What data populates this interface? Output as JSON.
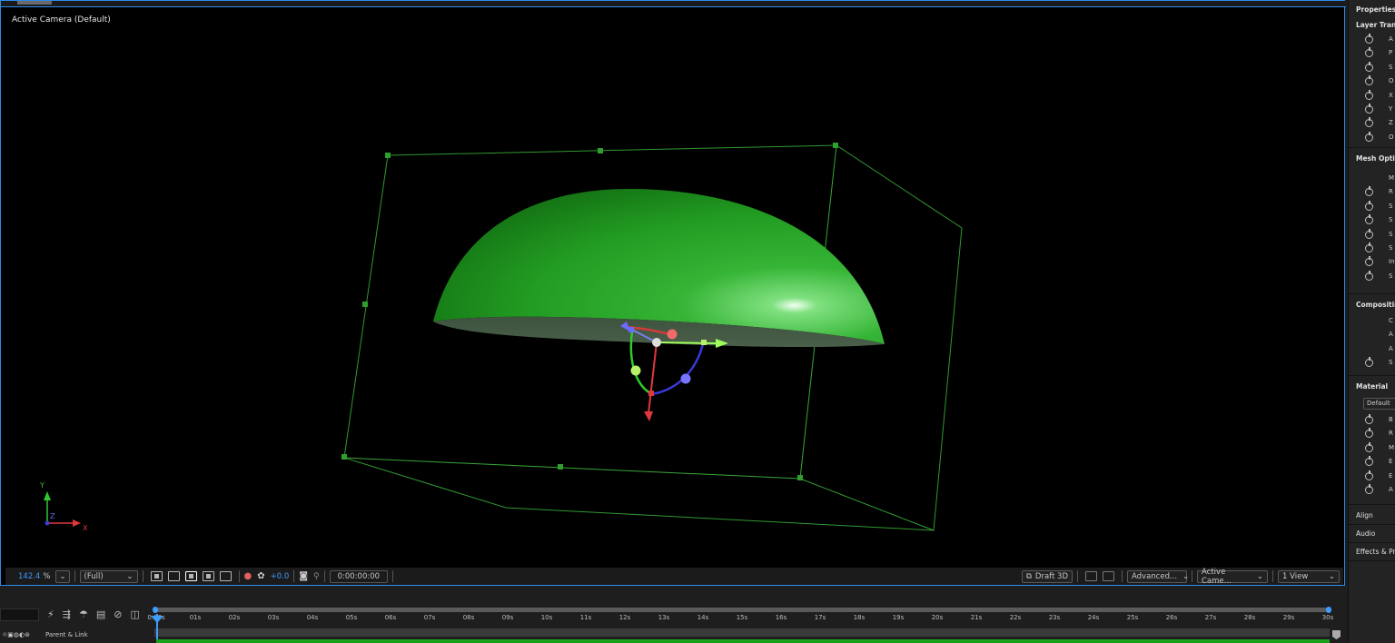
{
  "viewer": {
    "camera_label": "Active Camera (Default)",
    "axis_labels": {
      "y": "Y",
      "z": "Z",
      "x": "X"
    }
  },
  "toolbar": {
    "zoom": "142.4",
    "zoom_unit": "%",
    "resolution": "(Full)",
    "exposure": "+0.0",
    "timecode": "0:00:00:00",
    "renderer": "Draft 3D",
    "renderer_options": "Advanced...",
    "camera_view": "Active Came...",
    "view_layout": "1 View",
    "colors": {
      "accent": "#3e9cff"
    }
  },
  "timeline": {
    "parent_link_label": "Parent & Link",
    "ticks": [
      "0:00s",
      "01s",
      "02s",
      "03s",
      "04s",
      "05s",
      "06s",
      "07s",
      "08s",
      "09s",
      "10s",
      "11s",
      "12s",
      "13s",
      "14s",
      "15s",
      "16s",
      "17s",
      "18s",
      "19s",
      "20s",
      "21s",
      "22s",
      "23s",
      "24s",
      "25s",
      "26s",
      "27s",
      "28s",
      "29s",
      "30s"
    ]
  },
  "panel": {
    "header": "Properties:",
    "sections": [
      {
        "title": "Layer Trans",
        "rows": [
          {
            "label": "A"
          },
          {
            "label": "P"
          },
          {
            "label": "S"
          },
          {
            "label": "O"
          },
          {
            "label": "X"
          },
          {
            "label": "Y"
          },
          {
            "label": "Z"
          },
          {
            "label": "O"
          }
        ]
      },
      {
        "title": "Mesh Optio",
        "rows": [
          {
            "label": "M",
            "stopwatch": false
          },
          {
            "label": "R"
          },
          {
            "label": "S"
          },
          {
            "label": "S"
          },
          {
            "label": "S"
          },
          {
            "label": "S"
          },
          {
            "label": "In"
          },
          {
            "label": "S"
          }
        ]
      },
      {
        "title": "Compositin",
        "rows": [
          {
            "label": "C",
            "stopwatch": false
          },
          {
            "label": "A",
            "stopwatch": false
          },
          {
            "label": "A",
            "stopwatch": false
          },
          {
            "label": "S"
          }
        ]
      },
      {
        "title": "Material",
        "dropdown": "Default",
        "rows": [
          {
            "label": "B"
          },
          {
            "label": "R"
          },
          {
            "label": "M"
          },
          {
            "label": "E"
          },
          {
            "label": "E"
          },
          {
            "label": "A"
          }
        ]
      }
    ],
    "bottom_panels": [
      "Align",
      "Audio",
      "Effects & Pr"
    ]
  }
}
